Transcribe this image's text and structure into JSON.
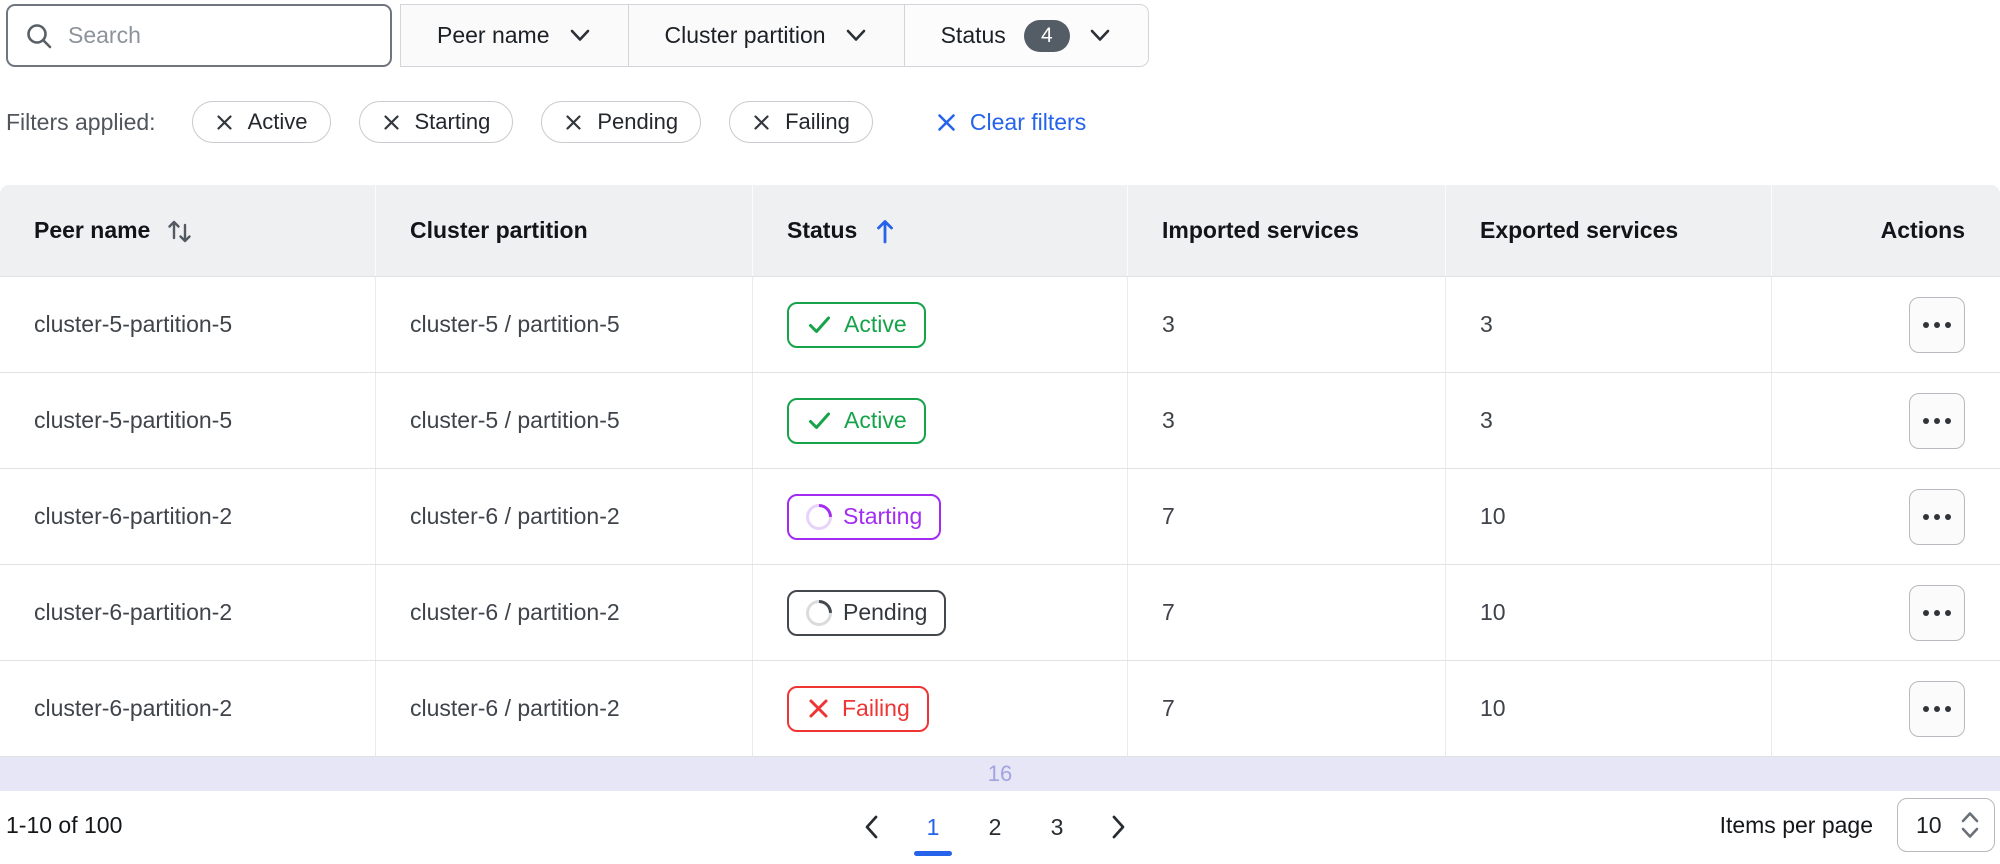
{
  "toolbar": {
    "search_placeholder": "Search",
    "filters": [
      {
        "label": "Peer name"
      },
      {
        "label": "Cluster partition"
      },
      {
        "label": "Status",
        "badge": "4"
      }
    ]
  },
  "filters_applied": {
    "label": "Filters applied:",
    "chips": [
      {
        "label": "Active"
      },
      {
        "label": "Starting"
      },
      {
        "label": "Pending"
      },
      {
        "label": "Failing"
      }
    ],
    "clear_label": "Clear filters"
  },
  "table": {
    "columns": {
      "peer_name": "Peer name",
      "cluster_partition": "Cluster partition",
      "status": "Status",
      "imported": "Imported services",
      "exported": "Exported services",
      "actions": "Actions"
    },
    "sort": {
      "peer_name": "unsorted",
      "status": "ascending"
    },
    "rows": [
      {
        "peer_name": "cluster-5-partition-5",
        "cluster_partition": "cluster-5 / partition-5",
        "status": "Active",
        "imported": "3",
        "exported": "3"
      },
      {
        "peer_name": "cluster-5-partition-5",
        "cluster_partition": "cluster-5 / partition-5",
        "status": "Active",
        "imported": "3",
        "exported": "3"
      },
      {
        "peer_name": "cluster-6-partition-2",
        "cluster_partition": "cluster-6 / partition-2",
        "status": "Starting",
        "imported": "7",
        "exported": "10"
      },
      {
        "peer_name": "cluster-6-partition-2",
        "cluster_partition": "cluster-6 / partition-2",
        "status": "Pending",
        "imported": "7",
        "exported": "10"
      },
      {
        "peer_name": "cluster-6-partition-2",
        "cluster_partition": "cluster-6 / partition-2",
        "status": "Failing",
        "imported": "7",
        "exported": "10"
      }
    ],
    "overlay_text": "16"
  },
  "pagination": {
    "range_label": "1-10 of 100",
    "pages": {
      "p1": "1",
      "p2": "2",
      "p3": "3"
    },
    "current_page": "1",
    "items_per_page_label": "Items per page",
    "items_per_page_value": "10"
  },
  "colors": {
    "accent_blue": "#2563eb",
    "status_active": "#16a34a",
    "status_starting": "#a32cf2",
    "status_pending": "#43484e",
    "status_failing": "#ef3434",
    "header_bg": "#eff0f2",
    "overlay_bg": "#e6e6f7",
    "badge_count_bg": "#545c66"
  }
}
